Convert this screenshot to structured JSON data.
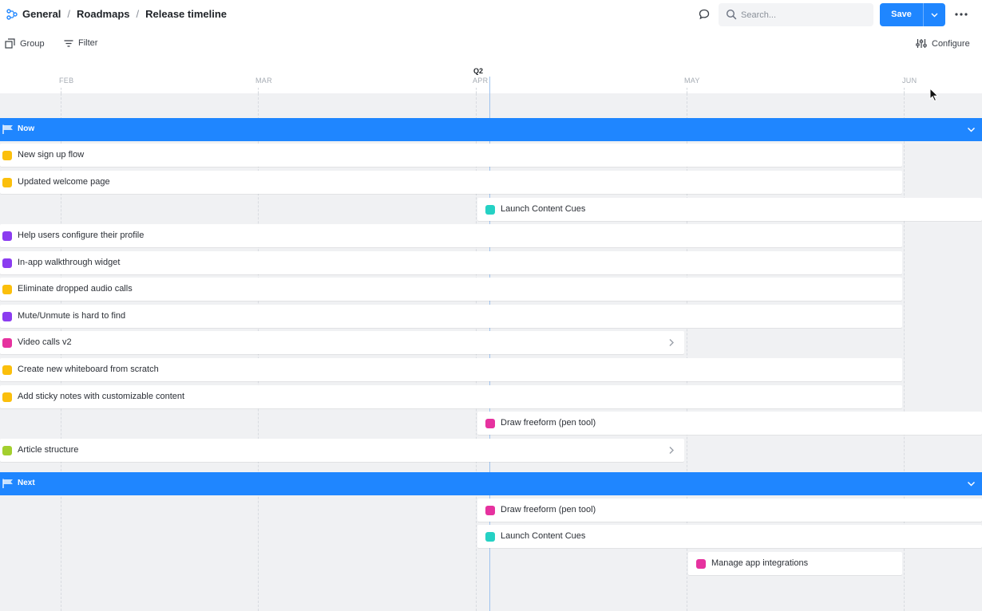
{
  "breadcrumb": [
    "General",
    "Roadmaps",
    "Release timeline"
  ],
  "breadcrumb_separator": "/",
  "search": {
    "placeholder": "Search..."
  },
  "save_button": {
    "label": "Save"
  },
  "toolbar": {
    "group_label": "Group",
    "filter_label": "Filter",
    "configure_label": "Configure"
  },
  "timeline": {
    "quarter_label": "Q2",
    "months": [
      "FEB",
      "MAR",
      "APR",
      "MAY",
      "JUN"
    ]
  },
  "colors": {
    "accent": "#1f86ff",
    "yellow": "#fbbf0c",
    "teal": "#25d1c4",
    "purple": "#8b3cf0",
    "pink": "#e6329f",
    "green": "#a3cf2e"
  },
  "groups": [
    {
      "name": "Now",
      "items": [
        {
          "label": "New sign up flow",
          "color": "yellow"
        },
        {
          "label": "Updated welcome page",
          "color": "yellow"
        },
        {
          "label": "Launch Content Cues",
          "color": "teal"
        },
        {
          "label": "Help users configure their profile",
          "color": "purple"
        },
        {
          "label": "In-app walkthrough widget",
          "color": "purple"
        },
        {
          "label": "Eliminate dropped audio calls",
          "color": "yellow"
        },
        {
          "label": "Mute/Unmute is hard to find",
          "color": "purple"
        },
        {
          "label": "Video calls v2",
          "color": "pink",
          "has_arrow": true
        },
        {
          "label": "Create new whiteboard from scratch",
          "color": "yellow"
        },
        {
          "label": "Add sticky notes with customizable content",
          "color": "yellow"
        },
        {
          "label": "Draw freeform (pen tool)",
          "color": "pink"
        },
        {
          "label": "Article structure",
          "color": "green",
          "has_arrow": true
        }
      ]
    },
    {
      "name": "Next",
      "items": [
        {
          "label": "Draw freeform (pen tool)",
          "color": "pink"
        },
        {
          "label": "Launch Content Cues",
          "color": "teal"
        },
        {
          "label": "Manage app integrations",
          "color": "pink"
        }
      ]
    }
  ]
}
